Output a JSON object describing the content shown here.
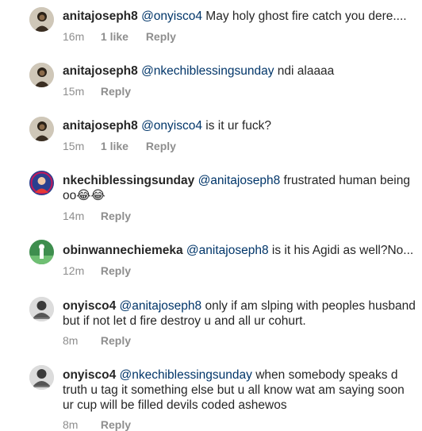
{
  "comments": [
    {
      "username": "anitajoseph8",
      "mention": "@onyisco4",
      "text": "May holy ghost fire catch you dere....",
      "time": "16m",
      "likes": "1 like",
      "reply": "Reply"
    },
    {
      "username": "anitajoseph8",
      "mention": "@nkechiblessingsunday",
      "text": "ndi alaaaa",
      "time": "15m",
      "likes": "",
      "reply": "Reply"
    },
    {
      "username": "anitajoseph8",
      "mention": "@onyisco4",
      "text": "is it ur fuck?",
      "time": "15m",
      "likes": "1 like",
      "reply": "Reply"
    },
    {
      "username": "nkechiblessingsunday",
      "mention": "@anitajoseph8",
      "text": "frustrated human being oo😂😂",
      "time": "14m",
      "likes": "",
      "reply": "Reply"
    },
    {
      "username": "obinwannechiemeka",
      "mention": "@anitajoseph8",
      "text": "is it his Agidi as well?No...",
      "time": "12m",
      "likes": "",
      "reply": "Reply"
    },
    {
      "username": "onyisco4",
      "mention": "@anitajoseph8",
      "text": "only if am slping with peoples husband but if not let d fire destroy u and all ur cohurt.",
      "time": "8m",
      "likes": "",
      "reply": "Reply"
    },
    {
      "username": "onyisco4",
      "mention": "@nkechiblessingsunday",
      "text": "when somebody speaks d truth u tag it something else but u all know wat am saying soon ur cup  will be filled  devils coded ashewos",
      "time": "8m",
      "likes": "",
      "reply": "Reply"
    }
  ]
}
